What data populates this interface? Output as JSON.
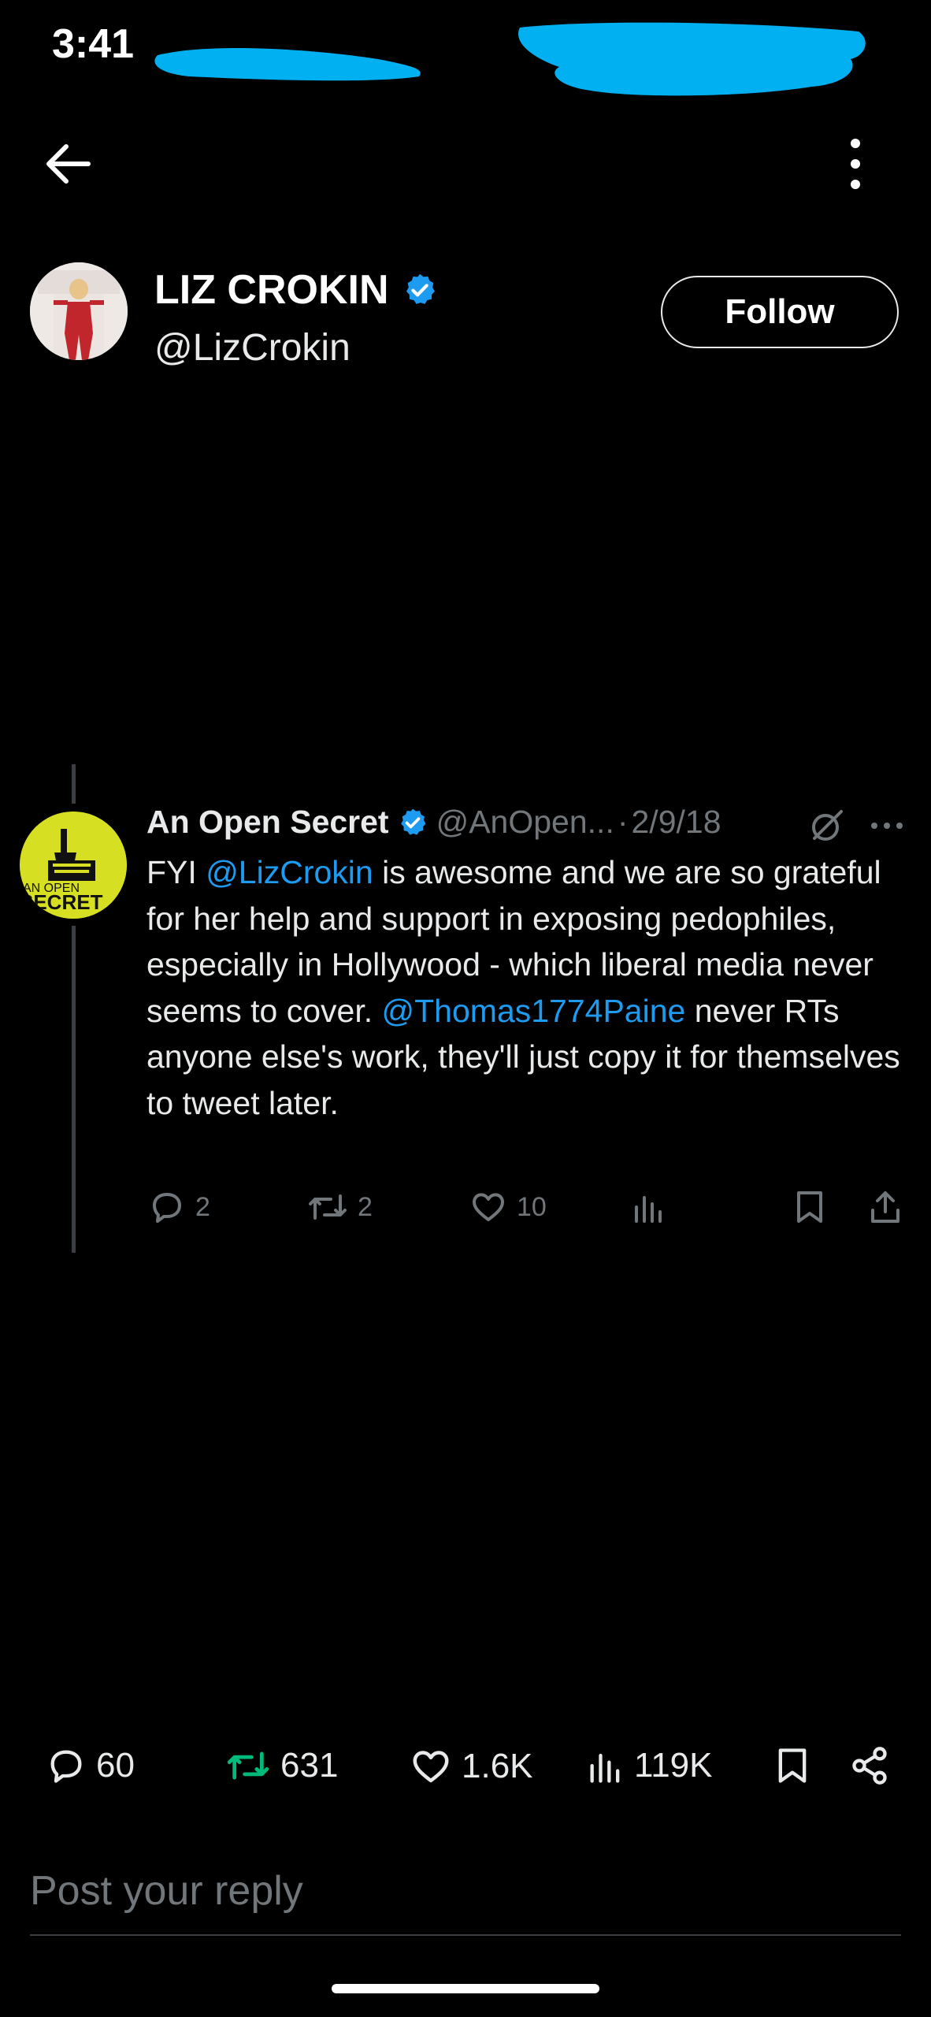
{
  "status_bar": {
    "time": "3:41"
  },
  "colors": {
    "accent": "#1d9bf0",
    "retweet_green": "#00ba7c",
    "redaction": "#00b0f0"
  },
  "nav": {
    "back_icon": "arrow-left-icon",
    "menu_icon": "more-vertical-icon"
  },
  "profile": {
    "display_name": "LIZ CROKIN",
    "handle": "@LizCrokin",
    "verified": true,
    "follow_label": "Follow"
  },
  "quoted_tweet": {
    "author_name": "An Open Secret",
    "author_handle": "@AnOpen...",
    "separator": "·",
    "date": "2/9/18",
    "avatar_text": "AN OPEN SECRET",
    "body": [
      {
        "text": "FYI ",
        "mention": false
      },
      {
        "text": "@LizCrokin",
        "mention": true
      },
      {
        "text": " is awesome and we are so grateful for her help and support in exposing pedophiles, especially in Hollywood - which liberal media never seems to cover. ",
        "mention": false
      },
      {
        "text": "@Thomas1774Paine",
        "mention": true
      },
      {
        "text": " never RTs anyone else's work, they'll just copy it for themselves to tweet later.",
        "mention": false
      }
    ],
    "replies": "2",
    "retweets": "2",
    "likes": "10"
  },
  "main_actions": {
    "replies": "60",
    "retweets": "631",
    "likes": "1.6K",
    "views": "119K"
  },
  "reply_box": {
    "placeholder": "Post your reply"
  }
}
